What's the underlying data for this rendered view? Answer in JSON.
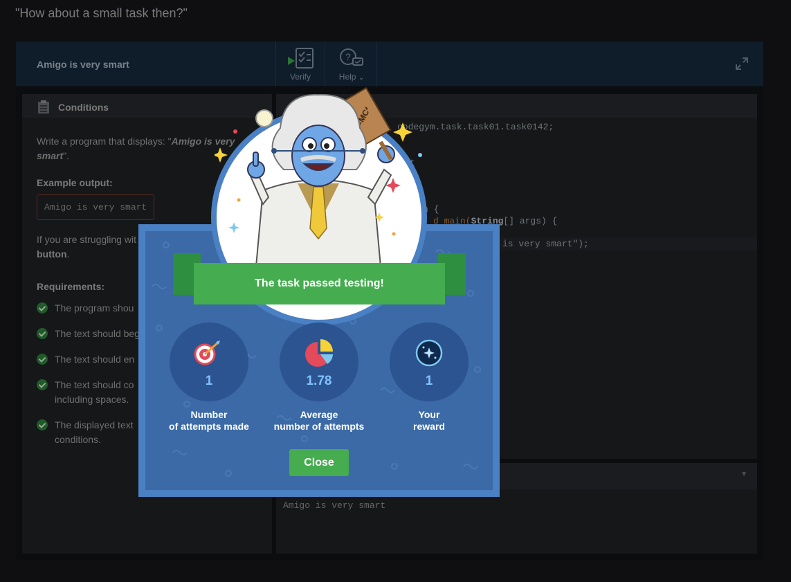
{
  "page": {
    "heading": "\"How about a small task then?\""
  },
  "ide": {
    "title": "Amigo is very smart",
    "verify_label": "Verify",
    "help_label": "Help"
  },
  "conditions": {
    "title": "Conditions",
    "intro_prefix": "Write a program that displays: \"",
    "intro_quote": "Amigo is very smart",
    "intro_suffix": "\".",
    "example_label": "Example output:",
    "example_value": "Amigo is very smart",
    "struggle_text": "If you are struggling wit",
    "struggle_bold": "button",
    "struggle_end": ".",
    "requirements_label": "Requirements:",
    "requirements": [
      "The program shou",
      "The text should beg",
      "The text should en",
      "The text should co",
      "The displayed text"
    ],
    "requirements_cont": [
      "including spaces.",
      "conditions."
    ]
  },
  "code": {
    "line1": "codegym.task.task01.task0142;",
    "line2": "t",
    "line3": "n {",
    "line4_kw1": "String",
    "line4": "d main(",
    "line4_end": "[] args) {",
    "line5": "is very smart\");"
  },
  "output": {
    "text": "Amigo is very smart"
  },
  "modal": {
    "banner": "The task passed testing!",
    "stats": [
      {
        "value": "1",
        "label_line1": "Number",
        "label_line2": "of attempts made"
      },
      {
        "value": "1.78",
        "label_line1": "Average",
        "label_line2": "number of attempts"
      },
      {
        "value": "1",
        "label_line1": "Your",
        "label_line2": "reward"
      }
    ],
    "close_label": "Close",
    "badge_text": "E=MC²"
  },
  "colors": {
    "modal_bg": "#3c6aa6",
    "ribbon": "#45ac4f",
    "stat_value": "#7fc3ff",
    "check": "#2f7d3a"
  }
}
